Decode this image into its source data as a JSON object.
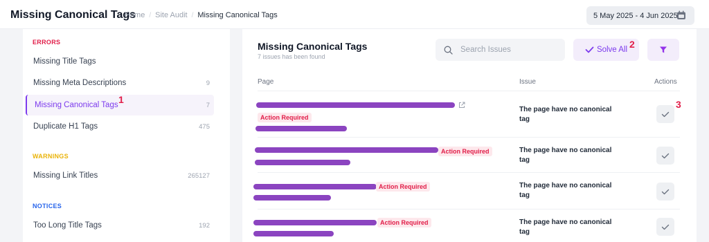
{
  "header": {
    "title": "Missing Canonical Tags",
    "breadcrumb": [
      "Home",
      "Site Audit",
      "Missing Canonical Tags"
    ],
    "date_range": "5 May 2025 - 4 Jun 2025"
  },
  "sidebar": {
    "sections": [
      {
        "label": "ERRORS",
        "color": "#e11d48",
        "items": [
          {
            "label": "Missing Title Tags",
            "count": ""
          },
          {
            "label": "Missing Meta Descriptions",
            "count": "9"
          },
          {
            "label": "Missing Canonical Tags",
            "count": "7",
            "active": true
          },
          {
            "label": "Duplicate H1 Tags",
            "count": "475"
          }
        ]
      },
      {
        "label": "WARNINGS",
        "color": "#eab308",
        "items": [
          {
            "label": "Missing Link Titles",
            "count": "265127"
          }
        ]
      },
      {
        "label": "NOTICES",
        "color": "#2563eb",
        "items": [
          {
            "label": "Too Long Title Tags",
            "count": "192"
          }
        ]
      }
    ]
  },
  "main": {
    "title": "Missing Canonical Tags",
    "subtitle": "7 issues has been found",
    "search_placeholder": "Search Issues",
    "solve_all_label": "Solve All",
    "columns": [
      "Page",
      "Issue",
      "Actions"
    ],
    "rows": [
      {
        "badge": "Action Required",
        "issue": "The page have no canonical tag"
      },
      {
        "badge": "Action Required",
        "issue": "The page have no canonical tag"
      },
      {
        "badge": "Action Required",
        "issue": "The page have no canonical tag"
      },
      {
        "badge": "Action Required",
        "issue": "The page have no canonical tag"
      }
    ]
  },
  "annotations": [
    "1",
    "2",
    "3"
  ],
  "colors": {
    "accent": "#7c3aed",
    "redaction": "#8b44c0",
    "badge_text": "#e11d48",
    "badge_bg": "#fde8ec",
    "annotation": "#e11d48"
  }
}
